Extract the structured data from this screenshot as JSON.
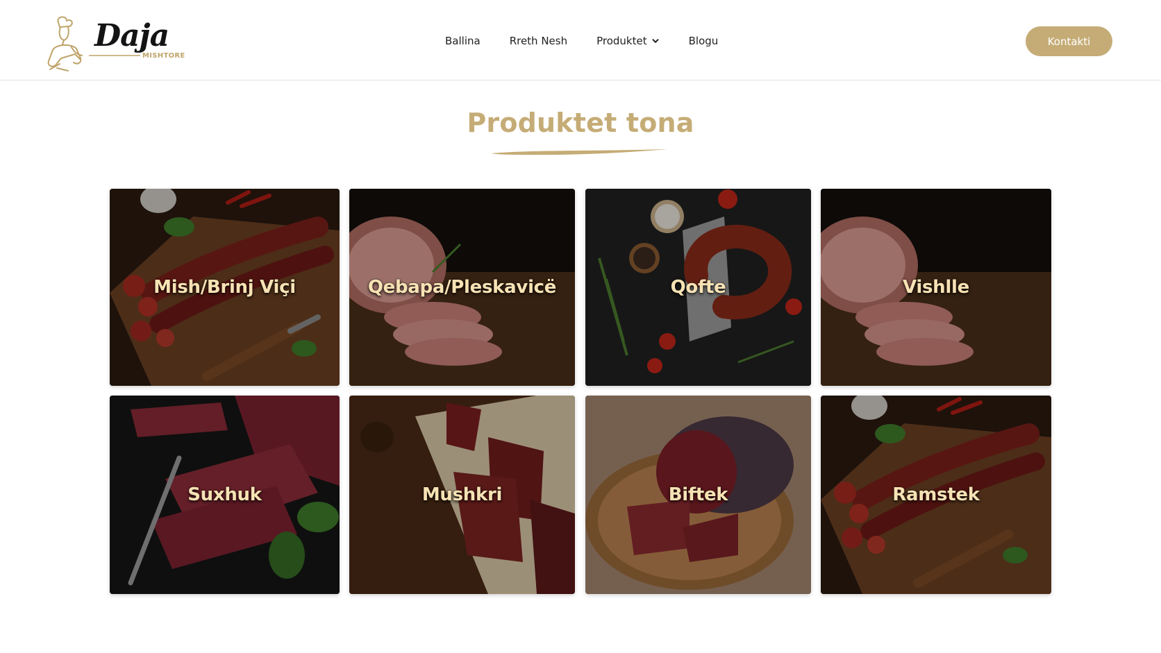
{
  "header": {
    "logo_text": "Daja",
    "logo_sub": "MISHTORE",
    "nav": [
      {
        "label": "Ballina"
      },
      {
        "label": "Rreth Nesh"
      },
      {
        "label": "Produktet"
      },
      {
        "label": "Blogu"
      }
    ],
    "cta_label": "Kontakti"
  },
  "section": {
    "title": "Produktet tona"
  },
  "products": [
    {
      "label": "Mish/Brinj Viçi",
      "image": "sausage-on-board"
    },
    {
      "label": "Qebapa/Pleskavicë",
      "image": "smoked-ham-slices"
    },
    {
      "label": "Qofte",
      "image": "ring-sausage-on-slate"
    },
    {
      "label": "Vishlle",
      "image": "smoked-ham-slices"
    },
    {
      "label": "Suxhuk",
      "image": "dried-meat-with-fork"
    },
    {
      "label": "Mushkri",
      "image": "beef-jerky-on-paper"
    },
    {
      "label": "Biftek",
      "image": "cured-beef-on-board"
    },
    {
      "label": "Ramstek",
      "image": "sausage-on-board"
    }
  ],
  "colors": {
    "accent": "#c5ac76",
    "label": "#f7e2b4"
  }
}
